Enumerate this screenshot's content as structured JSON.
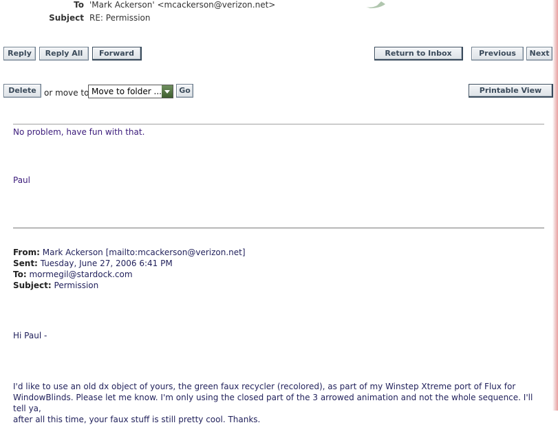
{
  "header": {
    "to_label": "To",
    "to_value": "'Mark Ackerson' <mcackerson@verizon.net>",
    "subject_label": "Subject",
    "subject_value": "RE: Permission"
  },
  "toolbar": {
    "reply": "Reply",
    "reply_all": "Reply All",
    "forward": "Forward",
    "return_to_inbox": "Return to Inbox",
    "previous": "Previous",
    "next": "Next",
    "delete": "Delete",
    "move_to_text": "or move to",
    "move_select_value": "Move to folder ...",
    "go": "Go",
    "printable_view": "Printable View"
  },
  "message": {
    "line1": "No problem, have fun with that.",
    "signature": "Paul"
  },
  "original": {
    "from_label": "From:",
    "from_value": "Mark Ackerson [mailto:mcackerson@verizon.net]",
    "sent_label": "Sent:",
    "sent_value": "Tuesday, June 27, 2006 6:41 PM",
    "to_label": "To:",
    "to_value": "mormegil@stardock.com",
    "subject_label": "Subject:",
    "subject_value": "Permission",
    "greeting": "Hi Paul -",
    "paragraph_line1": "I'd like to use an old dx object of yours, the green faux recycler (recolored), as part of my Winstep Xtreme port of Flux for",
    "paragraph_line2": "WindowBlinds. Please let me know. I'm only using the closed part of the 3 arrowed animation and not the whole sequence. I'll tell ya,",
    "paragraph_line3": "after all this time, your faux stuff is still pretty cool. Thanks."
  }
}
